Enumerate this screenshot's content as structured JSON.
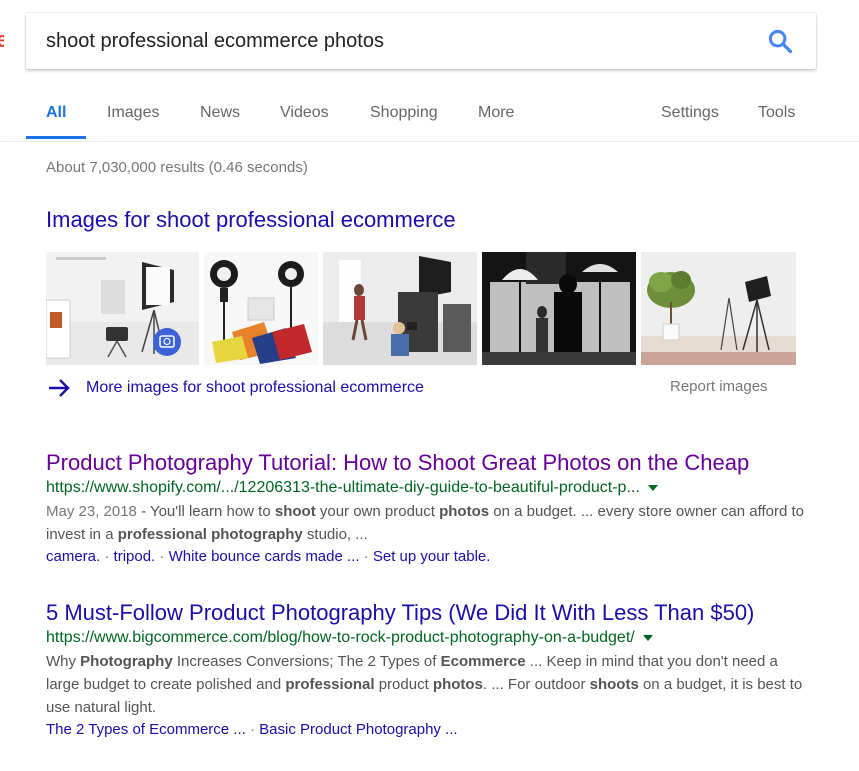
{
  "search": {
    "query": "shoot professional ecommerce photos"
  },
  "tabs": [
    {
      "label": "All",
      "active": true
    },
    {
      "label": "Images"
    },
    {
      "label": "News"
    },
    {
      "label": "Videos"
    },
    {
      "label": "Shopping"
    },
    {
      "label": "More"
    },
    {
      "label": "Settings"
    },
    {
      "label": "Tools"
    }
  ],
  "stats": "About 7,030,000 results (0.46 seconds)",
  "images": {
    "heading": "Images for shoot professional ecommerce",
    "more_label": "More images for shoot professional ecommerce",
    "report_label": "Report images"
  },
  "results": [
    {
      "title": "Product Photography Tutorial: How to Shoot Great Photos on the Cheap",
      "url": "https://www.shopify.com/.../12206313-the-ultimate-diy-guide-to-beautiful-product-p...",
      "date": "May 23, 2018",
      "snippet_parts": [
        " - You'll learn how to ",
        "shoot",
        " your own product ",
        "photos",
        " on a budget. ... every store owner can afford to invest in a ",
        "professional photography",
        " studio, ..."
      ],
      "links": [
        "camera.",
        "tripod.",
        "White bounce cards made ...",
        "Set up your table."
      ]
    },
    {
      "title": "5 Must-Follow Product Photography Tips (We Did It With Less Than $50)",
      "url": "https://www.bigcommerce.com/blog/how-to-rock-product-photography-on-a-budget/",
      "snippet_parts": [
        "Why ",
        "Photography",
        " Increases Conversions; The 2 Types of ",
        "Ecommerce",
        " ... Keep in mind that you don't need a large budget to create polished and ",
        "professional",
        " product ",
        "photos",
        ". ... For outdoor ",
        "shoots",
        " on a budget, it is best to use natural light."
      ],
      "links": [
        "The 2 Types of Ecommerce ...",
        "Basic Product Photography ..."
      ]
    }
  ],
  "colors": {
    "link": "#1a0dab",
    "visited": "#660099",
    "url": "#006621",
    "accent": "#1a73e8"
  }
}
